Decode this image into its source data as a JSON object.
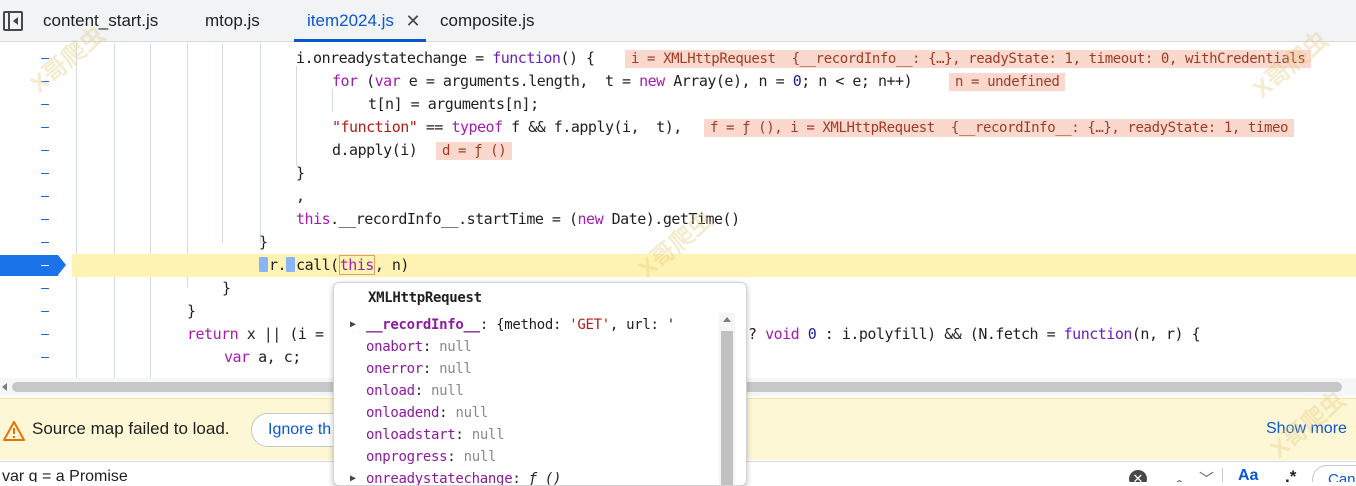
{
  "tabs": [
    {
      "label": "content_start.js",
      "active": false
    },
    {
      "label": "mtop.js",
      "active": false
    },
    {
      "label": "item2024.js",
      "active": true
    },
    {
      "label": "composite.js",
      "active": false
    }
  ],
  "tab_close_glyph": "✕",
  "gutter_mark": "–",
  "code": {
    "l1": {
      "a": "i.onreadystatechange = ",
      "kw": "function",
      "b": "() {",
      "inline": "i = XMLHttpRequest  {__recordInfo__: {…}, readyState: 1, timeout: 0, withCredentials"
    },
    "l2": {
      "kw1": "for",
      "a": " (",
      "kw2": "var",
      "b": " e = arguments.length,  t = ",
      "kw3": "new",
      "c": " Array(e), n = ",
      "num": "0",
      "d": "; n < e; n++)",
      "inline": "n = undefined"
    },
    "l3": {
      "a": "t[n] = arguments[n];"
    },
    "l4": {
      "str": "\"function\"",
      "a": " == ",
      "kw": "typeof",
      "b": " f && f.apply(i,  t),",
      "inline": "f = ƒ (), i = XMLHttpRequest  {__recordInfo__: {…}, readyState: 1, timeo"
    },
    "l5": {
      "a": "d.apply(i)",
      "inline": "d = ƒ ()"
    },
    "l6": {
      "a": "}"
    },
    "l7": {
      "a": ","
    },
    "l8": {
      "kw": "this",
      "a": ".__recordInfo__.startTime = (",
      "kw2": "new",
      "b": " Date).getTime()"
    },
    "l9": {
      "a": "}"
    },
    "l10": {
      "a": "r.",
      "b": "call(",
      "kw": "this",
      "c": ", n)"
    },
    "l11": {
      "a": "}"
    },
    "l12": {
      "a": "}"
    },
    "l13": {
      "kw": "return",
      "a": " x || (i =",
      "b": "? ",
      "kw2": "void",
      "c": " ",
      "num": "0",
      "d": " : i.polyfill) && (N.fetch = ",
      "kw3": "function",
      "e": "(n, r) {"
    },
    "l14": {
      "kw": "var",
      "a": " a, c;"
    }
  },
  "popover": {
    "title": "XMLHttpRequest",
    "rows": [
      {
        "key": "__recordInfo__",
        "value": ": {method: ",
        "str": "'GET'",
        "rest": ", url: '",
        "expandable": true
      },
      {
        "key": "onabort",
        "value": "null",
        "expandable": false
      },
      {
        "key": "onerror",
        "value": "null",
        "expandable": false
      },
      {
        "key": "onload",
        "value": "null",
        "expandable": false
      },
      {
        "key": "onloadend",
        "value": "null",
        "expandable": false
      },
      {
        "key": "onloadstart",
        "value": "null",
        "expandable": false
      },
      {
        "key": "onprogress",
        "value": "null",
        "expandable": false
      },
      {
        "key": "onreadystatechange",
        "value": "ƒ ()",
        "expandable": true
      }
    ]
  },
  "warning": {
    "text": "Source map failed to load.",
    "ignore_button": "Ignore th",
    "show_more": "Show more"
  },
  "search": {
    "query": "var g = a Promise",
    "match_case_label": "Aa",
    "regex_label": ".*",
    "cancel_label": "Cancel"
  },
  "watermark": "X哥爬虫",
  "colors": {
    "accent": "#0b57d0",
    "exec_line": "#fff3b3",
    "inline_value_bg": "#fbd8cd",
    "warning_bg": "#fef7d6"
  }
}
